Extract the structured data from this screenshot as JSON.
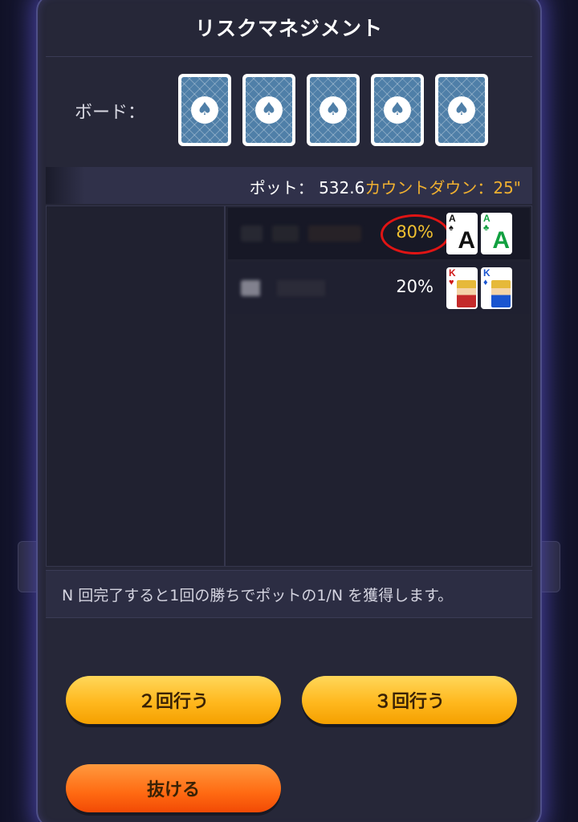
{
  "dialog": {
    "title": "リスクマネジメント",
    "board_label": "ボード：",
    "board_cards": [
      "card-back",
      "card-back",
      "card-back",
      "card-back",
      "card-back"
    ]
  },
  "info": {
    "pot_label": "ポット：",
    "pot_value": "532.6",
    "countdown_label": "カウントダウン：",
    "countdown_value": "25\""
  },
  "players": [
    {
      "equity": "80%",
      "highlighted": true,
      "cards": [
        {
          "rank": "A",
          "suit": "♠",
          "color": "#111111"
        },
        {
          "rank": "A",
          "suit": "♣",
          "color": "#12a040"
        }
      ]
    },
    {
      "equity": "20%",
      "highlighted": false,
      "cards": [
        {
          "rank": "K",
          "suit": "♥",
          "color": "#d01818"
        },
        {
          "rank": "K",
          "suit": "♦",
          "color": "#1a55d0"
        }
      ]
    }
  ],
  "footer": {
    "note": "N 回完了すると1回の勝ちでポットの1/N を獲得します。"
  },
  "buttons": {
    "run_twice": "２回行う",
    "run_three": "３回行う",
    "exit": "抜ける"
  },
  "colors": {
    "accent_gold": "#f0b030",
    "highlight_circle": "#e01414",
    "panel_bg": "#262738"
  }
}
